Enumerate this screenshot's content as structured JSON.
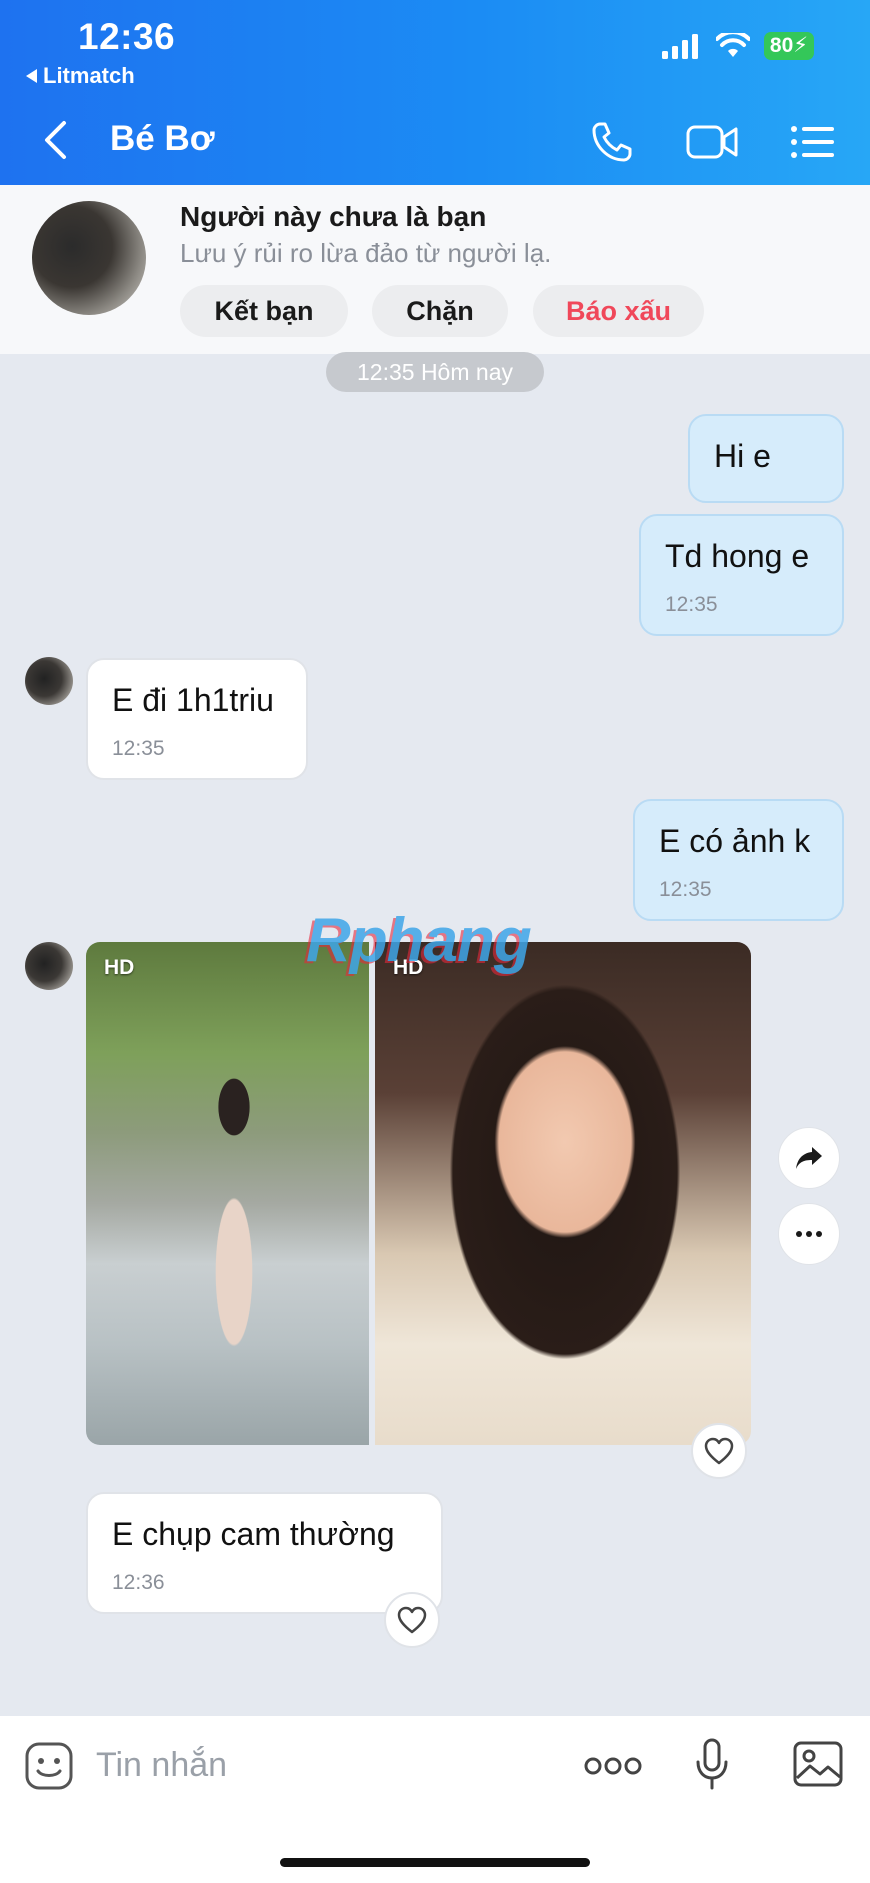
{
  "status_bar": {
    "time": "12:36",
    "back_app": "Litmatch",
    "battery": "80"
  },
  "header": {
    "title": "Bé Bơ"
  },
  "banner": {
    "title": "Người này chưa là bạn",
    "subtitle": "Lưu ý rủi ro lừa đảo từ người lạ.",
    "buttons": {
      "add_friend": "Kết bạn",
      "block": "Chặn",
      "report": "Báo xấu"
    }
  },
  "date_chip": "12:35 Hôm nay",
  "messages": [
    {
      "dir": "out",
      "text": "Hi e",
      "time": ""
    },
    {
      "dir": "out",
      "text": "Td hong e",
      "time": "12:35"
    },
    {
      "dir": "in",
      "text": "E đi 1h1triu",
      "time": "12:35"
    },
    {
      "dir": "out",
      "text": "E có ảnh k",
      "time": "12:35"
    },
    {
      "dir": "in",
      "text": "E chụp cam thường",
      "time": "12:36"
    }
  ],
  "photos": [
    {
      "badge": "HD"
    },
    {
      "badge": "HD"
    }
  ],
  "watermark": "Rphang",
  "input": {
    "placeholder": "Tin nhắn"
  },
  "colors": {
    "header_start": "#1e72f0",
    "header_end": "#27a7f6",
    "report": "#f0485a",
    "out_bubble": "#d6ecfb"
  }
}
